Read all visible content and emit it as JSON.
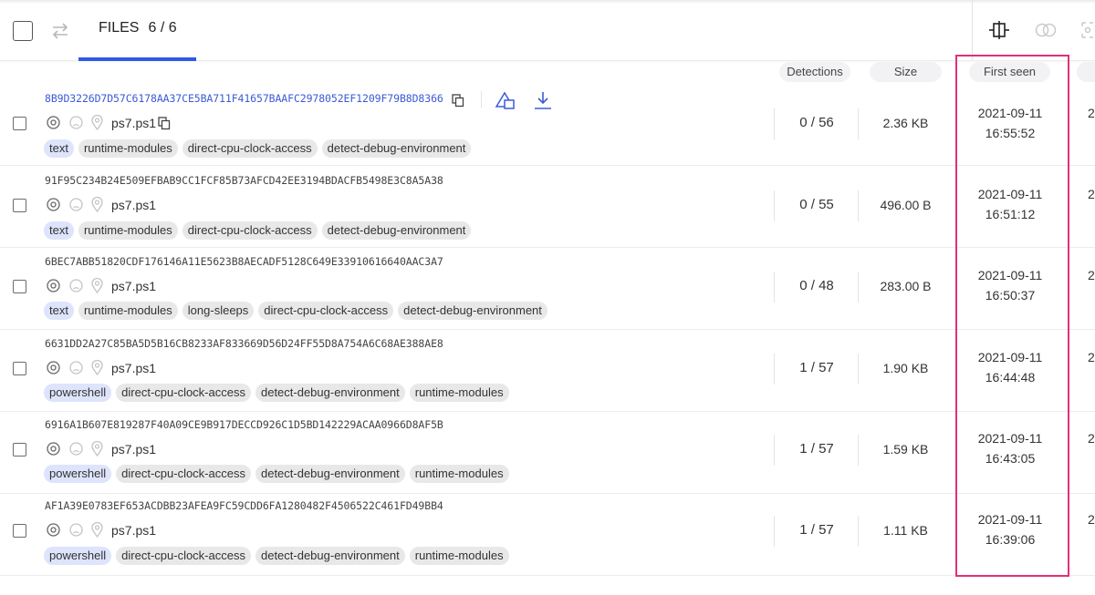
{
  "header": {
    "files_label": "FILES",
    "files_count": "6 / 6"
  },
  "columns": {
    "detections": "Detections",
    "size": "Size",
    "first_seen": "First seen"
  },
  "rows": [
    {
      "hash": "8B9D3226D7D57C6178AA37CE5BA711F41657BAAFC2978052EF1209F79B8D8366",
      "filename": "ps7.ps1",
      "tags": [
        "text",
        "runtime-modules",
        "direct-cpu-clock-access",
        "detect-debug-environment"
      ],
      "detections": "0 / 56",
      "size": "2.36 KB",
      "first_seen_date": "2021-09-11",
      "first_seen_time": "16:55:52",
      "edge": "2"
    },
    {
      "hash": "91F95C234B24E509EFBAB9CC1FCF85B73AFCD42EE3194BDACFB5498E3C8A5A38",
      "filename": "ps7.ps1",
      "tags": [
        "text",
        "runtime-modules",
        "direct-cpu-clock-access",
        "detect-debug-environment"
      ],
      "detections": "0 / 55",
      "size": "496.00 B",
      "first_seen_date": "2021-09-11",
      "first_seen_time": "16:51:12",
      "edge": "2"
    },
    {
      "hash": "6BEC7ABB51820CDF176146A11E5623B8AECADF5128C649E33910616640AAC3A7",
      "filename": "ps7.ps1",
      "tags": [
        "text",
        "runtime-modules",
        "long-sleeps",
        "direct-cpu-clock-access",
        "detect-debug-environment"
      ],
      "detections": "0 / 48",
      "size": "283.00 B",
      "first_seen_date": "2021-09-11",
      "first_seen_time": "16:50:37",
      "edge": "2"
    },
    {
      "hash": "6631DD2A27C85BA5D5B16CB8233AF833669D56D24FF55D8A754A6C68AE388AE8",
      "filename": "ps7.ps1",
      "tags": [
        "powershell",
        "direct-cpu-clock-access",
        "detect-debug-environment",
        "runtime-modules"
      ],
      "detections": "1 / 57",
      "size": "1.90 KB",
      "first_seen_date": "2021-09-11",
      "first_seen_time": "16:44:48",
      "edge": "2"
    },
    {
      "hash": "6916A1B607E819287F40A09CE9B917DECCD926C1D5BD142229ACAA0966D8AF5B",
      "filename": "ps7.ps1",
      "tags": [
        "powershell",
        "direct-cpu-clock-access",
        "detect-debug-environment",
        "runtime-modules"
      ],
      "detections": "1 / 57",
      "size": "1.59 KB",
      "first_seen_date": "2021-09-11",
      "first_seen_time": "16:43:05",
      "edge": "2"
    },
    {
      "hash": "AF1A39E0783EF653ACDBB23AFEA9FC59CDD6FA1280482F4506522C461FD49BB4",
      "filename": "ps7.ps1",
      "tags": [
        "powershell",
        "direct-cpu-clock-access",
        "detect-debug-environment",
        "runtime-modules"
      ],
      "detections": "1 / 57",
      "size": "1.11 KB",
      "first_seen_date": "2021-09-11",
      "first_seen_time": "16:39:06",
      "edge": "2"
    }
  ],
  "colors": {
    "accent": "#2f58e8",
    "link": "#3b5bd6",
    "highlight": "#e0307a",
    "tag_blue": "#dde4fb",
    "tag_gray": "#e8e8e8"
  }
}
